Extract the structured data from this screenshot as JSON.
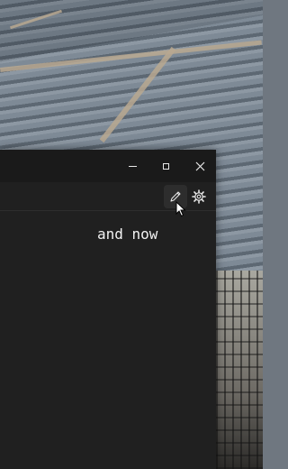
{
  "window": {
    "title_controls": {
      "minimize_icon": "minimize-icon",
      "maximize_icon": "maximize-icon",
      "close_icon": "close-icon"
    },
    "toolbar": {
      "edit_icon": "pencil-icon",
      "settings_icon": "gear-icon"
    },
    "content": {
      "text": "and now"
    }
  },
  "colors": {
    "window_bg": "#202020",
    "titlebar_bg": "#1a1a1a",
    "text": "#f2f2f2",
    "hover_bg": "#2d2d2d"
  }
}
